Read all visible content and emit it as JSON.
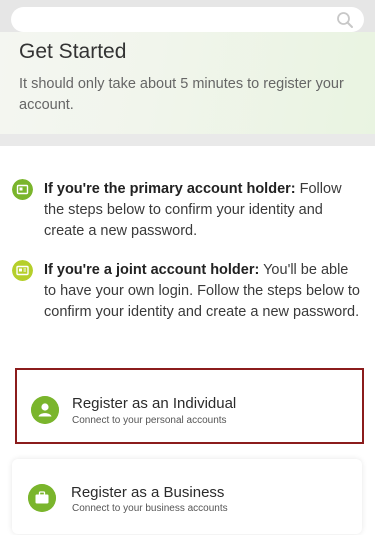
{
  "search": {
    "placeholder": "",
    "value": ""
  },
  "hero": {
    "title": "Get Started",
    "subtitle": "It should only take about 5 minutes to register your account."
  },
  "info": [
    {
      "icon": "id-card-icon",
      "bold": "If you're the primary account holder:",
      "text": " Follow the steps below to confirm your identity and create a new password."
    },
    {
      "icon": "id-card-icon",
      "bold": "If you're a joint account holder:",
      "text": " You'll be able to have your own login. Follow the steps below to confirm your identity and create a new password."
    }
  ],
  "options": [
    {
      "icon": "person-icon",
      "title": "Register as an Individual",
      "subtitle": "Connect to your personal accounts",
      "selected": true
    },
    {
      "icon": "briefcase-icon",
      "title": "Register as a Business",
      "subtitle": "Connect to your business accounts",
      "selected": false
    }
  ],
  "colors": {
    "accent": "#7ab52c",
    "accent_light": "#b5cf2b",
    "selected_border": "#8b1c1c"
  }
}
